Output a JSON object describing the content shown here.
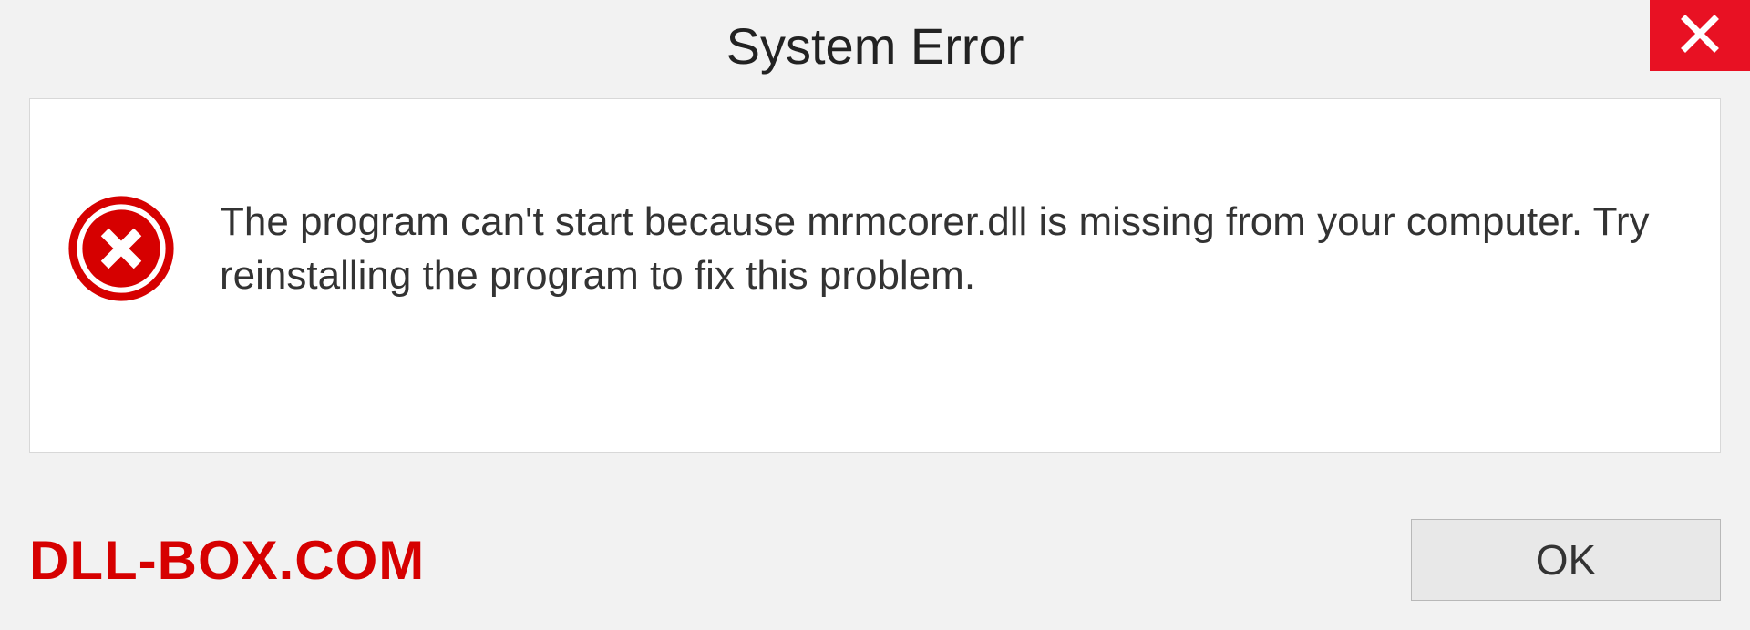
{
  "dialog": {
    "title": "System Error",
    "message": "The program can't start because mrmcorer.dll is missing from your computer. Try reinstalling the program to fix this problem.",
    "ok_label": "OK"
  },
  "watermark": "DLL-BOX.COM",
  "colors": {
    "close_bg": "#e81123",
    "error_icon": "#d60000",
    "watermark": "#d60000"
  }
}
